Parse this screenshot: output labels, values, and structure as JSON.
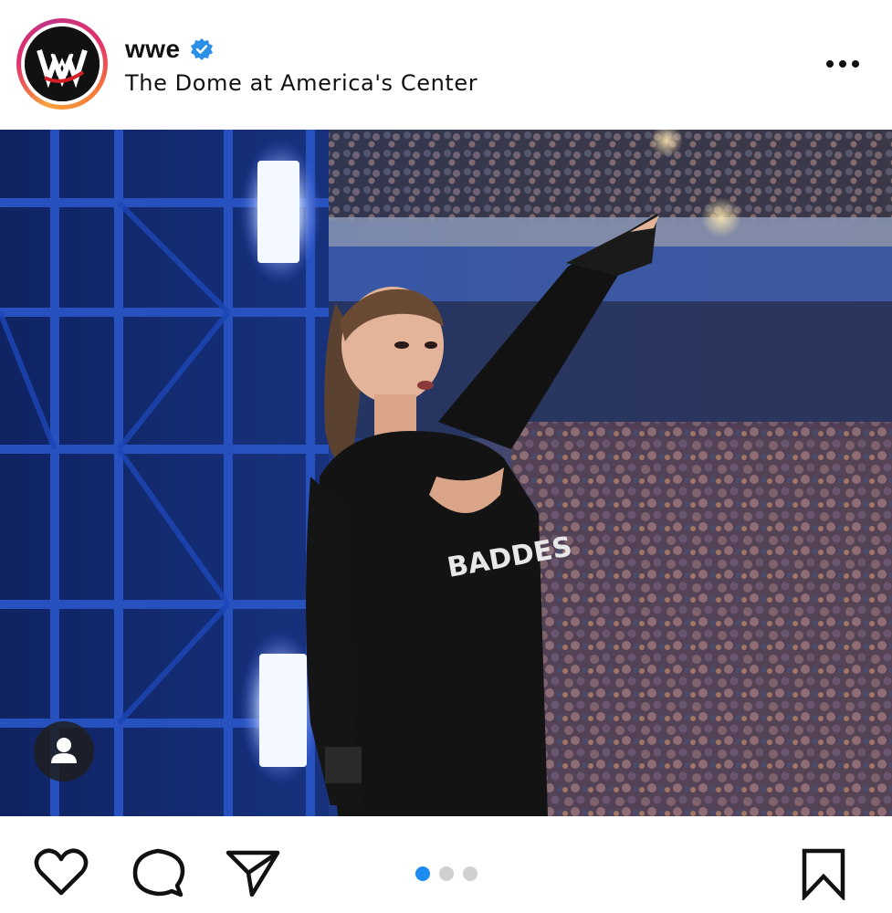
{
  "post": {
    "username": "wwe",
    "location": "The Dome at America's Center",
    "verified": true,
    "avatar_logo": "wwe-logo",
    "shirt_text": "BADDES",
    "carousel": {
      "total": 3,
      "active_index": 0
    },
    "colors": {
      "verified_badge": "#2b8fe8",
      "active_dot": "#1d8cf0",
      "inactive_dot": "#d0d0d0",
      "icon": "#111111"
    },
    "icons": {
      "more": "more-horizontal-icon",
      "like": "heart-icon",
      "comment": "comment-icon",
      "share": "paper-plane-icon",
      "save": "bookmark-icon",
      "tag": "user-tag-icon"
    }
  }
}
